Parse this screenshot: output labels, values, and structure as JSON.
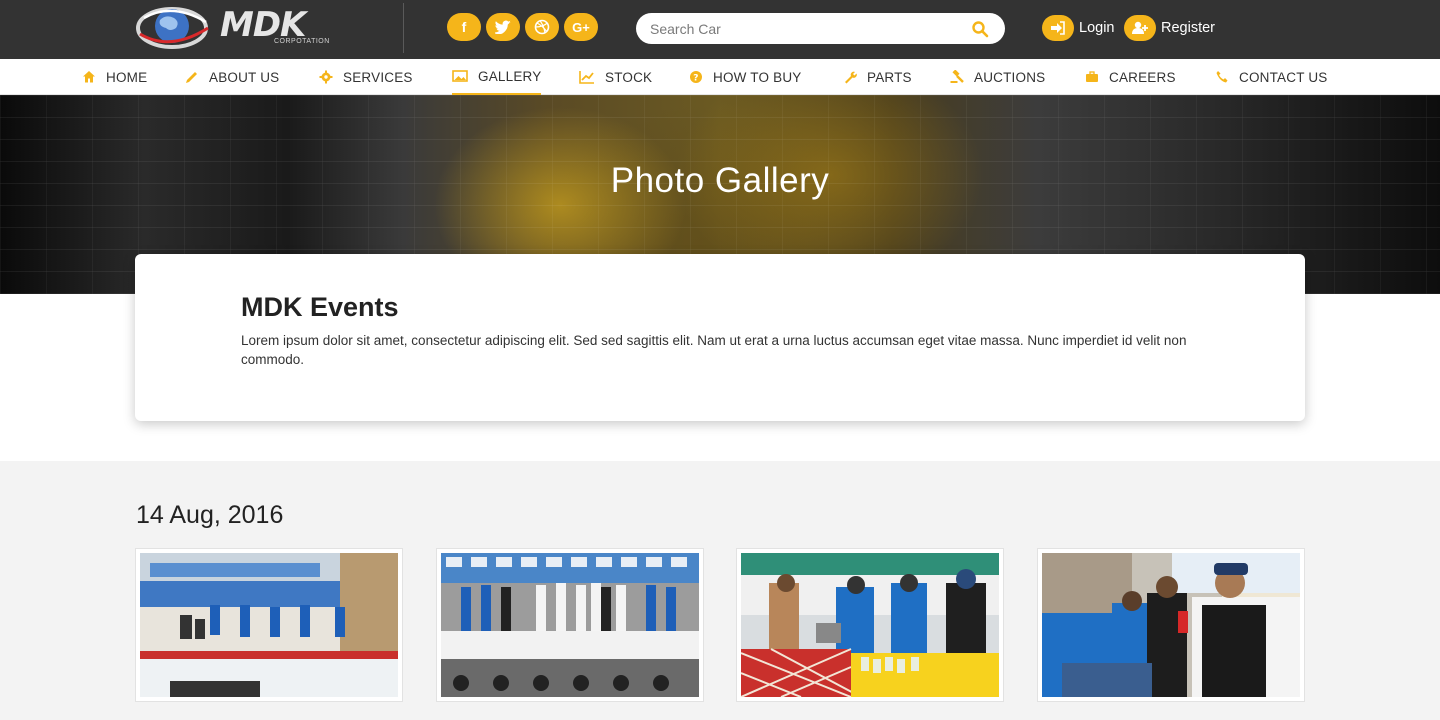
{
  "brand": {
    "name": "MDK",
    "sub": "CORPOTATION"
  },
  "social": [
    {
      "icon": "facebook-icon",
      "glyph": "f"
    },
    {
      "icon": "twitter-icon",
      "glyph": "t"
    },
    {
      "icon": "dribbble-icon",
      "glyph": "◎"
    },
    {
      "icon": "google-plus-icon",
      "glyph": "G+"
    }
  ],
  "search": {
    "placeholder": "Search Car"
  },
  "auth": {
    "login": "Login",
    "register": "Register"
  },
  "nav": [
    {
      "label": "HOME",
      "icon": "home-icon"
    },
    {
      "label": "ABOUT US",
      "icon": "pencil-icon"
    },
    {
      "label": "SERVICES",
      "icon": "gear-icon"
    },
    {
      "label": "GALLERY",
      "icon": "image-icon",
      "active": true
    },
    {
      "label": "STOCK",
      "icon": "chart-icon"
    },
    {
      "label": "HOW TO BUY",
      "icon": "question-icon"
    },
    {
      "label": "PARTS",
      "icon": "wrench-icon"
    },
    {
      "label": "AUCTIONS",
      "icon": "gavel-icon"
    },
    {
      "label": "CAREERS",
      "icon": "briefcase-icon"
    },
    {
      "label": "CONTACT US",
      "icon": "phone-icon"
    }
  ],
  "hero": {
    "title": "Photo Gallery"
  },
  "intro": {
    "heading": "MDK Events",
    "text": "Lorem ipsum dolor sit amet, consectetur adipiscing elit. Sed sed sagittis elit. Nam ut erat a urna luctus accumsan eget vitae massa. Nunc imperdiet id velit non commodo."
  },
  "gallery": {
    "date": "14 Aug, 2016"
  },
  "colors": {
    "accent": "#f5b51a",
    "topbar": "#333333",
    "gallery_bg": "#f3f3f3"
  }
}
